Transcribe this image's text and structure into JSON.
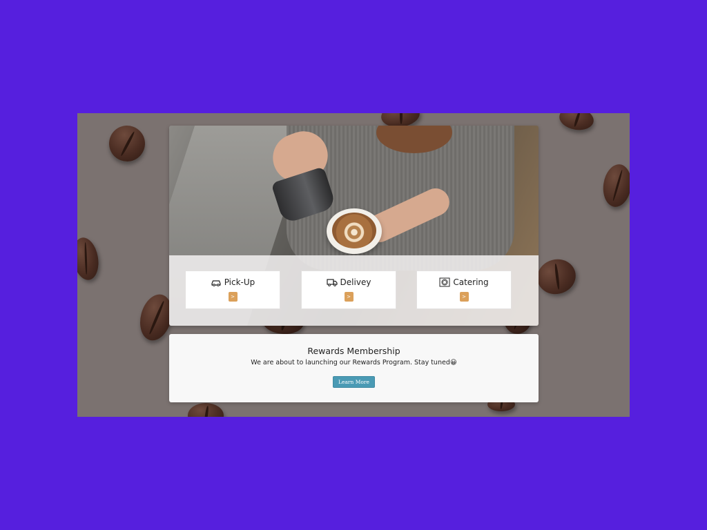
{
  "hero": {
    "image_alt": "barista pouring latte art"
  },
  "services": [
    {
      "icon": "car-icon",
      "label": "Pick-Up",
      "action": ">"
    },
    {
      "icon": "truck-icon",
      "label": "Delivey",
      "action": ">"
    },
    {
      "icon": "plate-icon",
      "label": "Catering",
      "action": ">"
    }
  ],
  "rewards": {
    "title": "Rewards Membership",
    "text": "We are about to launching our Rewards Program. Stay tuned😀",
    "button": "Learn More"
  },
  "colors": {
    "frame": "#561fde",
    "panel": "#7b7270",
    "action_button": "#dba05a",
    "learn_button": "#4a9ab4"
  }
}
